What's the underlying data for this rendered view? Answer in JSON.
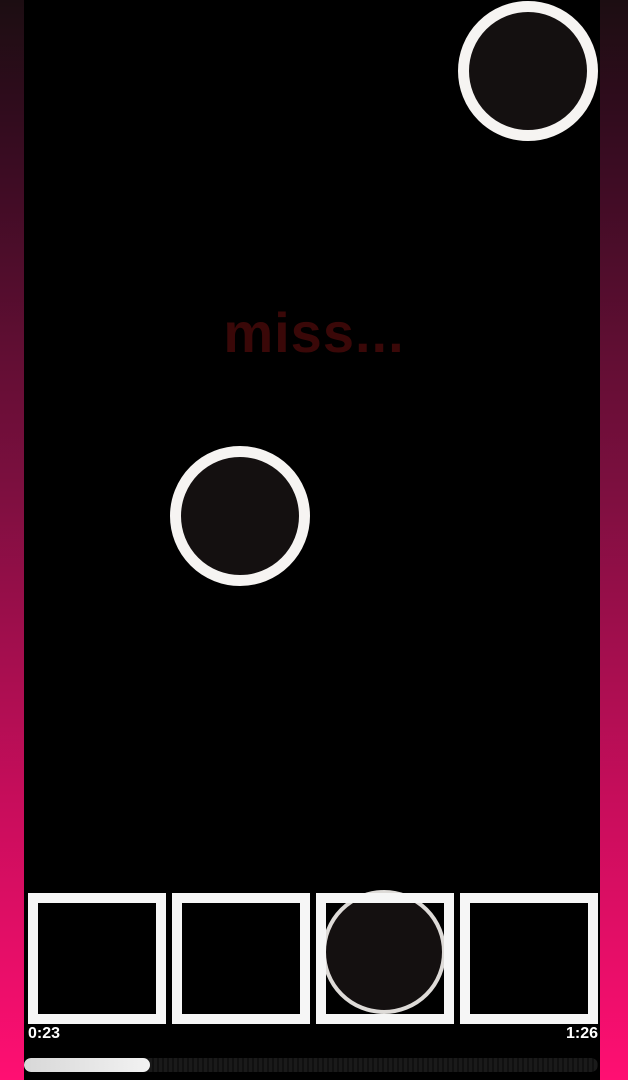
{
  "status": {
    "text": "miss...",
    "color": "#3a0808"
  },
  "notes": [
    {
      "lane": 4,
      "shape": "circle-note"
    },
    {
      "lane": 2,
      "shape": "circle-note"
    },
    {
      "lane": 3,
      "shape": "circle-note"
    }
  ],
  "lanes": [
    {
      "index": 1
    },
    {
      "index": 2
    },
    {
      "index": 3
    },
    {
      "index": 4
    }
  ],
  "playback": {
    "elapsed": "0:23",
    "total": "1:26",
    "progress": 0.22
  },
  "colors": {
    "accent": "#ff0f72",
    "note_fill": "#141010",
    "note_ring": "#f6f4f2",
    "lane_border": "#f6f6f6"
  }
}
